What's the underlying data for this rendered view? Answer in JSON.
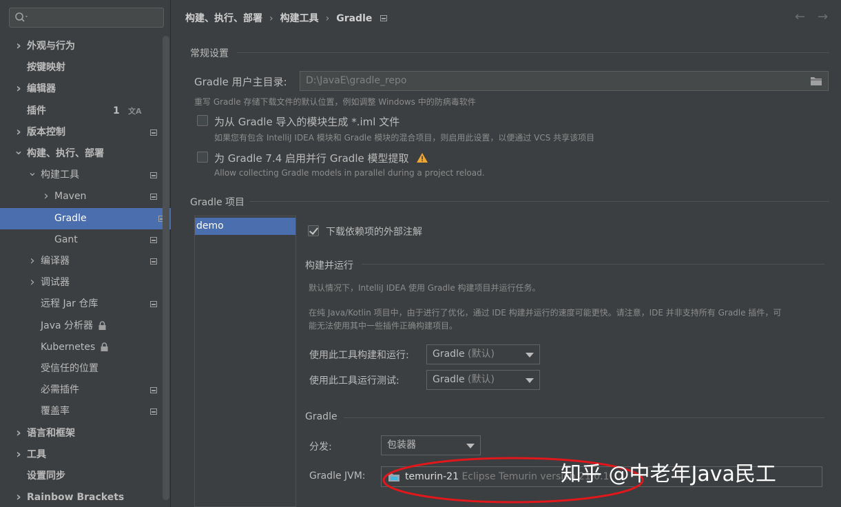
{
  "search": {
    "placeholder": ""
  },
  "sidebar": {
    "items": [
      {
        "label": "外观与行为",
        "bold": true,
        "chevron": "›",
        "indent": 0
      },
      {
        "label": "按键映射",
        "bold": true,
        "chevron": "",
        "indent": 0
      },
      {
        "label": "编辑器",
        "bold": true,
        "chevron": "›",
        "indent": 0
      },
      {
        "label": "插件",
        "bold": true,
        "chevron": "",
        "indent": 0,
        "badge": "1"
      },
      {
        "label": "版本控制",
        "bold": true,
        "chevron": "›",
        "indent": 0
      },
      {
        "label": "构建、执行、部署",
        "bold": true,
        "chevron": "⌄",
        "indent": 0
      },
      {
        "label": "构建工具",
        "bold": false,
        "chevron": "⌄",
        "indent": 1
      },
      {
        "label": "Maven",
        "bold": false,
        "chevron": "›",
        "indent": 2
      },
      {
        "label": "Gradle",
        "bold": false,
        "chevron": "",
        "indent": 2,
        "selected": true
      },
      {
        "label": "Gant",
        "bold": false,
        "chevron": "",
        "indent": 2
      },
      {
        "label": "编译器",
        "bold": false,
        "chevron": "›",
        "indent": 1
      },
      {
        "label": "调试器",
        "bold": false,
        "chevron": "›",
        "indent": 1
      },
      {
        "label": "远程 Jar 仓库",
        "bold": false,
        "chevron": "",
        "indent": 1
      },
      {
        "label": "Java 分析器",
        "bold": false,
        "chevron": "",
        "indent": 1,
        "locked": true
      },
      {
        "label": "Kubernetes",
        "bold": false,
        "chevron": "",
        "indent": 1,
        "locked": true
      },
      {
        "label": "受信任的位置",
        "bold": false,
        "chevron": "",
        "indent": 1
      },
      {
        "label": "必需插件",
        "bold": false,
        "chevron": "",
        "indent": 1
      },
      {
        "label": "覆盖率",
        "bold": false,
        "chevron": "",
        "indent": 1
      },
      {
        "label": "语言和框架",
        "bold": true,
        "chevron": "›",
        "indent": 0
      },
      {
        "label": "工具",
        "bold": true,
        "chevron": "›",
        "indent": 0
      },
      {
        "label": "设置同步",
        "bold": true,
        "chevron": "",
        "indent": 0
      },
      {
        "label": "Rainbow Brackets",
        "bold": true,
        "chevron": "›",
        "indent": 0
      }
    ]
  },
  "breadcrumb": {
    "part1": "构建、执行、部署",
    "part2": "构建工具",
    "part3": "Gradle"
  },
  "general": {
    "title": "常规设置",
    "user_home_label": "Gradle 用户主目录:",
    "user_home_value": "D:\\JavaE\\gradle_repo",
    "user_home_hint": "重写 Gradle 存储下载文件的默认位置，例如调整 Windows 中的防病毒软件",
    "iml_label": "为从 Gradle 导入的模块生成 *.iml 文件",
    "iml_hint": "如果您有包含 IntelliJ IDEA 模块和 Gradle 模块的混合项目，则启用此设置，以便通过 VCS 共享该项目",
    "parallel_label": "为 Gradle 7.4 启用并行 Gradle 模型提取",
    "parallel_hint": "Allow collecting Gradle models in parallel during a project reload."
  },
  "projects": {
    "title": "Gradle 项目",
    "items": [
      "demo"
    ]
  },
  "project_settings": {
    "download_annotations": "下载依赖项的外部注解",
    "build_run_title": "构建并运行",
    "build_run_desc1": "默认情况下，IntelliJ IDEA 使用 Gradle 构建项目并运行任务。",
    "build_run_desc2a": "在纯 Java/Kotlin 项目中，由于进行了优化，通过 IDE 构建并运行的速度可能更快。请注意，IDE 并非支持所有 Gradle 插件，可",
    "build_run_desc2b": "能无法使用其中一些插件正确构建项目。",
    "build_with_label": "使用此工具构建和运行:",
    "build_with_value": "Gradle",
    "build_with_suffix": "(默认)",
    "test_with_label": "使用此工具运行测试:",
    "test_with_value": "Gradle",
    "test_with_suffix": "(默认)",
    "gradle_title": "Gradle",
    "distribution_label": "分发:",
    "distribution_value": "包装器",
    "jvm_label": "Gradle JVM:",
    "jvm_value": "temurin-21",
    "jvm_desc": "Eclipse Temurin version 21.0.1"
  },
  "watermark": "知乎 @中老年Java民工",
  "colors": {
    "selection": "#4b6eaf",
    "background": "#3c3f41",
    "annotation": "#e0171b"
  }
}
